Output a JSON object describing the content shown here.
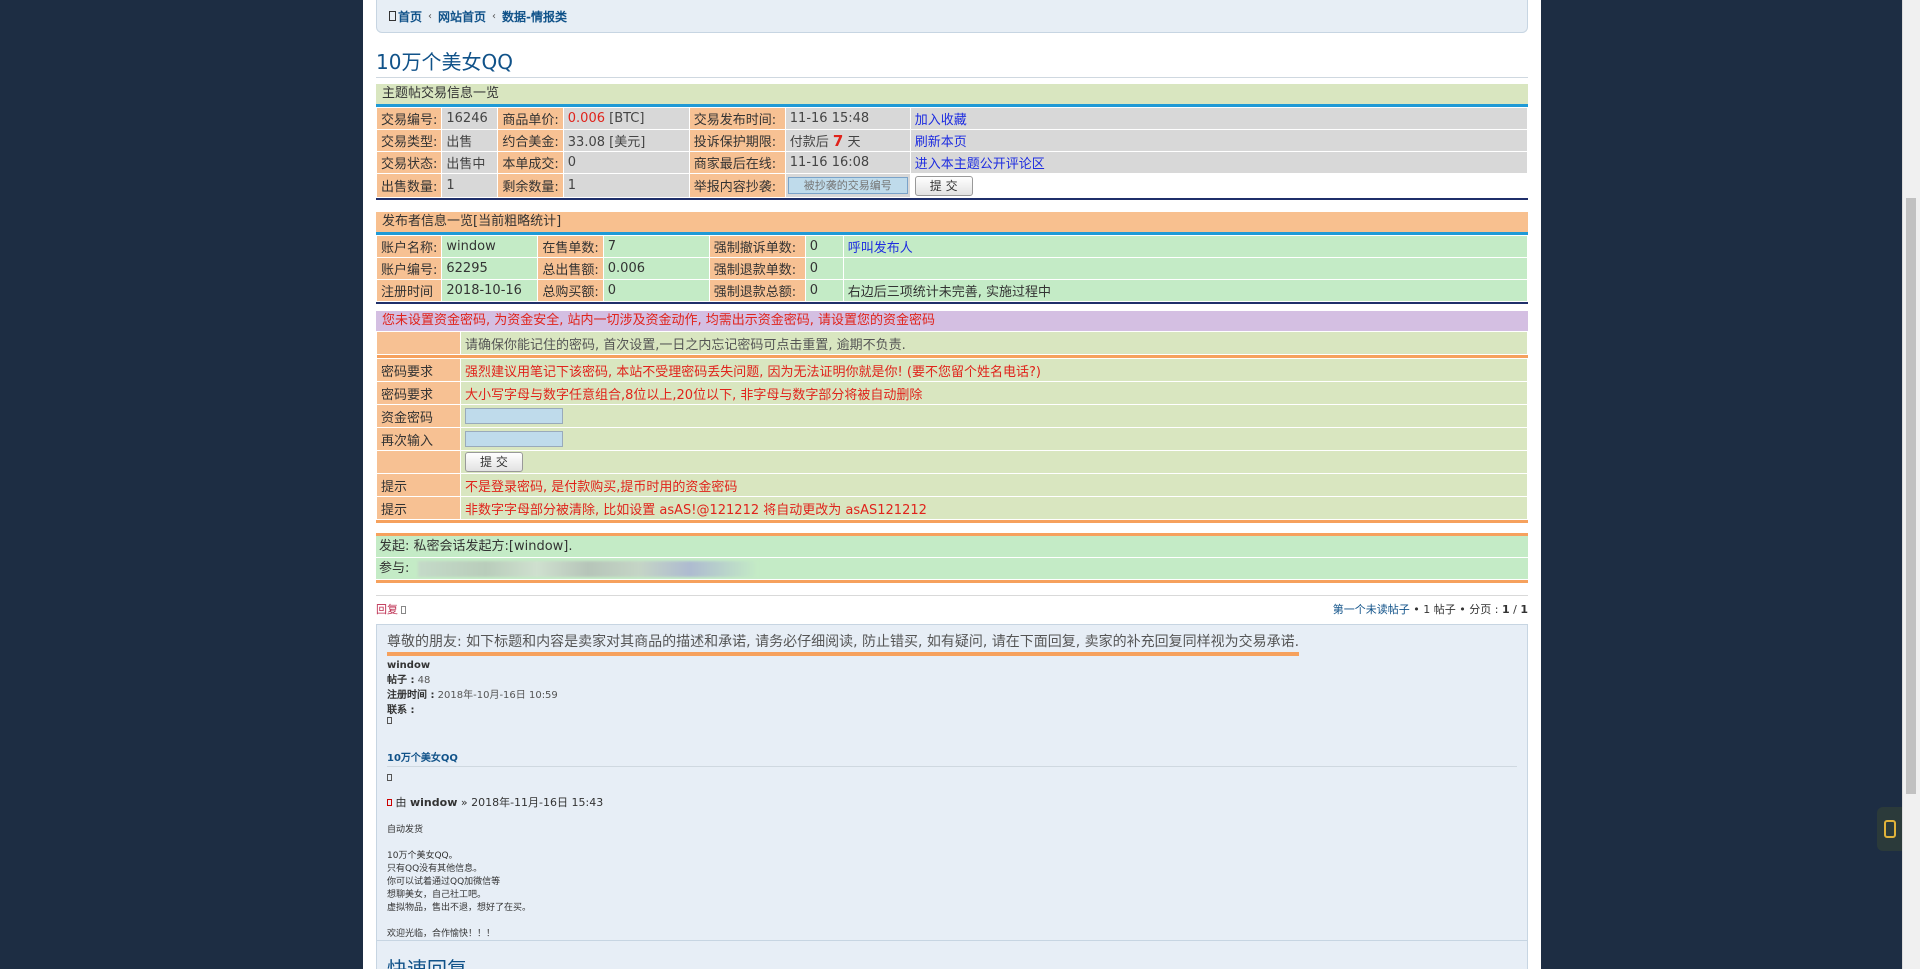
{
  "breadcrumb": {
    "items": [
      "首页",
      "网站首页",
      "数据-情报类"
    ]
  },
  "topic_title": "10万个美女QQ",
  "trade": {
    "header": "主题帖交易信息一览",
    "rows": [
      {
        "k1": "交易编号:",
        "v1": "16246",
        "k2": "商品单价:",
        "v2_num": "0.006",
        "v2_unit": " [BTC]",
        "k3": "交易发布时间:",
        "v3": "11-16 15:48",
        "link": "加入收藏"
      },
      {
        "k1": "交易类型:",
        "v1": "出售",
        "k2": "约合美金:",
        "v2": "33.08 [美元]",
        "k3": "投诉保护期限:",
        "v3_pre": "付款后 ",
        "v3_num": "7",
        "v3_post": " 天",
        "link": "刷新本页"
      },
      {
        "k1": "交易状态:",
        "v1": "出售中",
        "k2": "本单成交:",
        "v2": "0",
        "k3": "商家最后在线:",
        "v3": "11-16 16:08",
        "link": "进入本主题公开评论区"
      },
      {
        "k1": "出售数量:",
        "v1": "1",
        "k2": "剩余数量:",
        "v2": "1",
        "k3": "举报内容抄袭:",
        "placeholder": "被抄袭的交易编号",
        "submit": "提 交"
      }
    ]
  },
  "publisher": {
    "header": "发布者信息一览[当前粗略统计]",
    "rows": [
      {
        "k1": "账户名称:",
        "v1": "window",
        "k2": "在售单数:",
        "v2": "7",
        "k3": "强制撤诉单数:",
        "v3": "0",
        "extra": "呼叫发布人"
      },
      {
        "k1": "账户编号:",
        "v1": "62295",
        "k2": "总出售额:",
        "v2": "0.006",
        "k3": "强制退款单数:",
        "v3": "0",
        "extra": ""
      },
      {
        "k1": "注册时间",
        "v1": "2018-10-16",
        "k2": "总购买额:",
        "v2": "0",
        "k3": "强制退款总额:",
        "v3": "0",
        "extra": "右边后三项统计未完善, 实施过程中"
      }
    ]
  },
  "password": {
    "header": "您未设置资金密码, 为资金安全, 站内一切涉及资金动作, 均需出示资金密码, 请设置您的资金密码",
    "intro": "请确保你能记住的密码, 首次设置,一日之内忘记密码可点击重置, 逾期不负责.",
    "req_label": "密码要求",
    "req1": "强烈建议用笔记下该密码, 本站不受理密码丢失问题, 因为无法证明你就是你! (要不您留个姓名电话?)",
    "req2": "大小写字母与数字任意组合,8位以上,20位以下, 非字母与数字部分将被自动删除",
    "pw_label": "资金密码",
    "pw2_label": "再次输入",
    "submit": "提 交",
    "tip_label": "提示",
    "tip1": "不是登录密码, 是付款购买,提币时用的资金密码",
    "tip2": "非数字字母部分被清除, 比如设置 asAS!@121212 将自动更改为 asAS121212"
  },
  "session": {
    "initiator_label": "发起:",
    "initiator_text": "私密会话发起方:[window].",
    "participants_label": "参与:"
  },
  "actions": {
    "reply": "回复",
    "first_unread": "第一个未读帖子",
    "post_count": "1 帖子",
    "pagination_label": "分页 :",
    "page_current": "1",
    "page_total": "1"
  },
  "post": {
    "notice": "尊敬的朋友: 如下标题和内容是卖家对其商品的描述和承诺, 请务必仔细阅读, 防止错买, 如有疑问, 请在下面回复, 卖家的补充回复同样视为交易承诺.",
    "author": "window",
    "posts_label": "帖子 :",
    "posts_value": "48",
    "joined_label": "注册时间 :",
    "joined_value": "2018年-10月-16日 10:59",
    "contact_label": "联系 :",
    "title": "10万个美女QQ",
    "by": "由",
    "byline_author": "window",
    "byline_date": "» 2018年-11月-16日 15:43",
    "body": [
      "自动发货",
      "",
      "10万个美女QQ。",
      "只有QQ没有其他信息。",
      "你可以试着通过QQ加微信等",
      "想聊美女，自己社工吧。",
      "虚拟物品，售出不退，想好了在买。",
      "",
      "欢迎光临，合作愉快！！！"
    ]
  },
  "quick_reply": "快速回复"
}
